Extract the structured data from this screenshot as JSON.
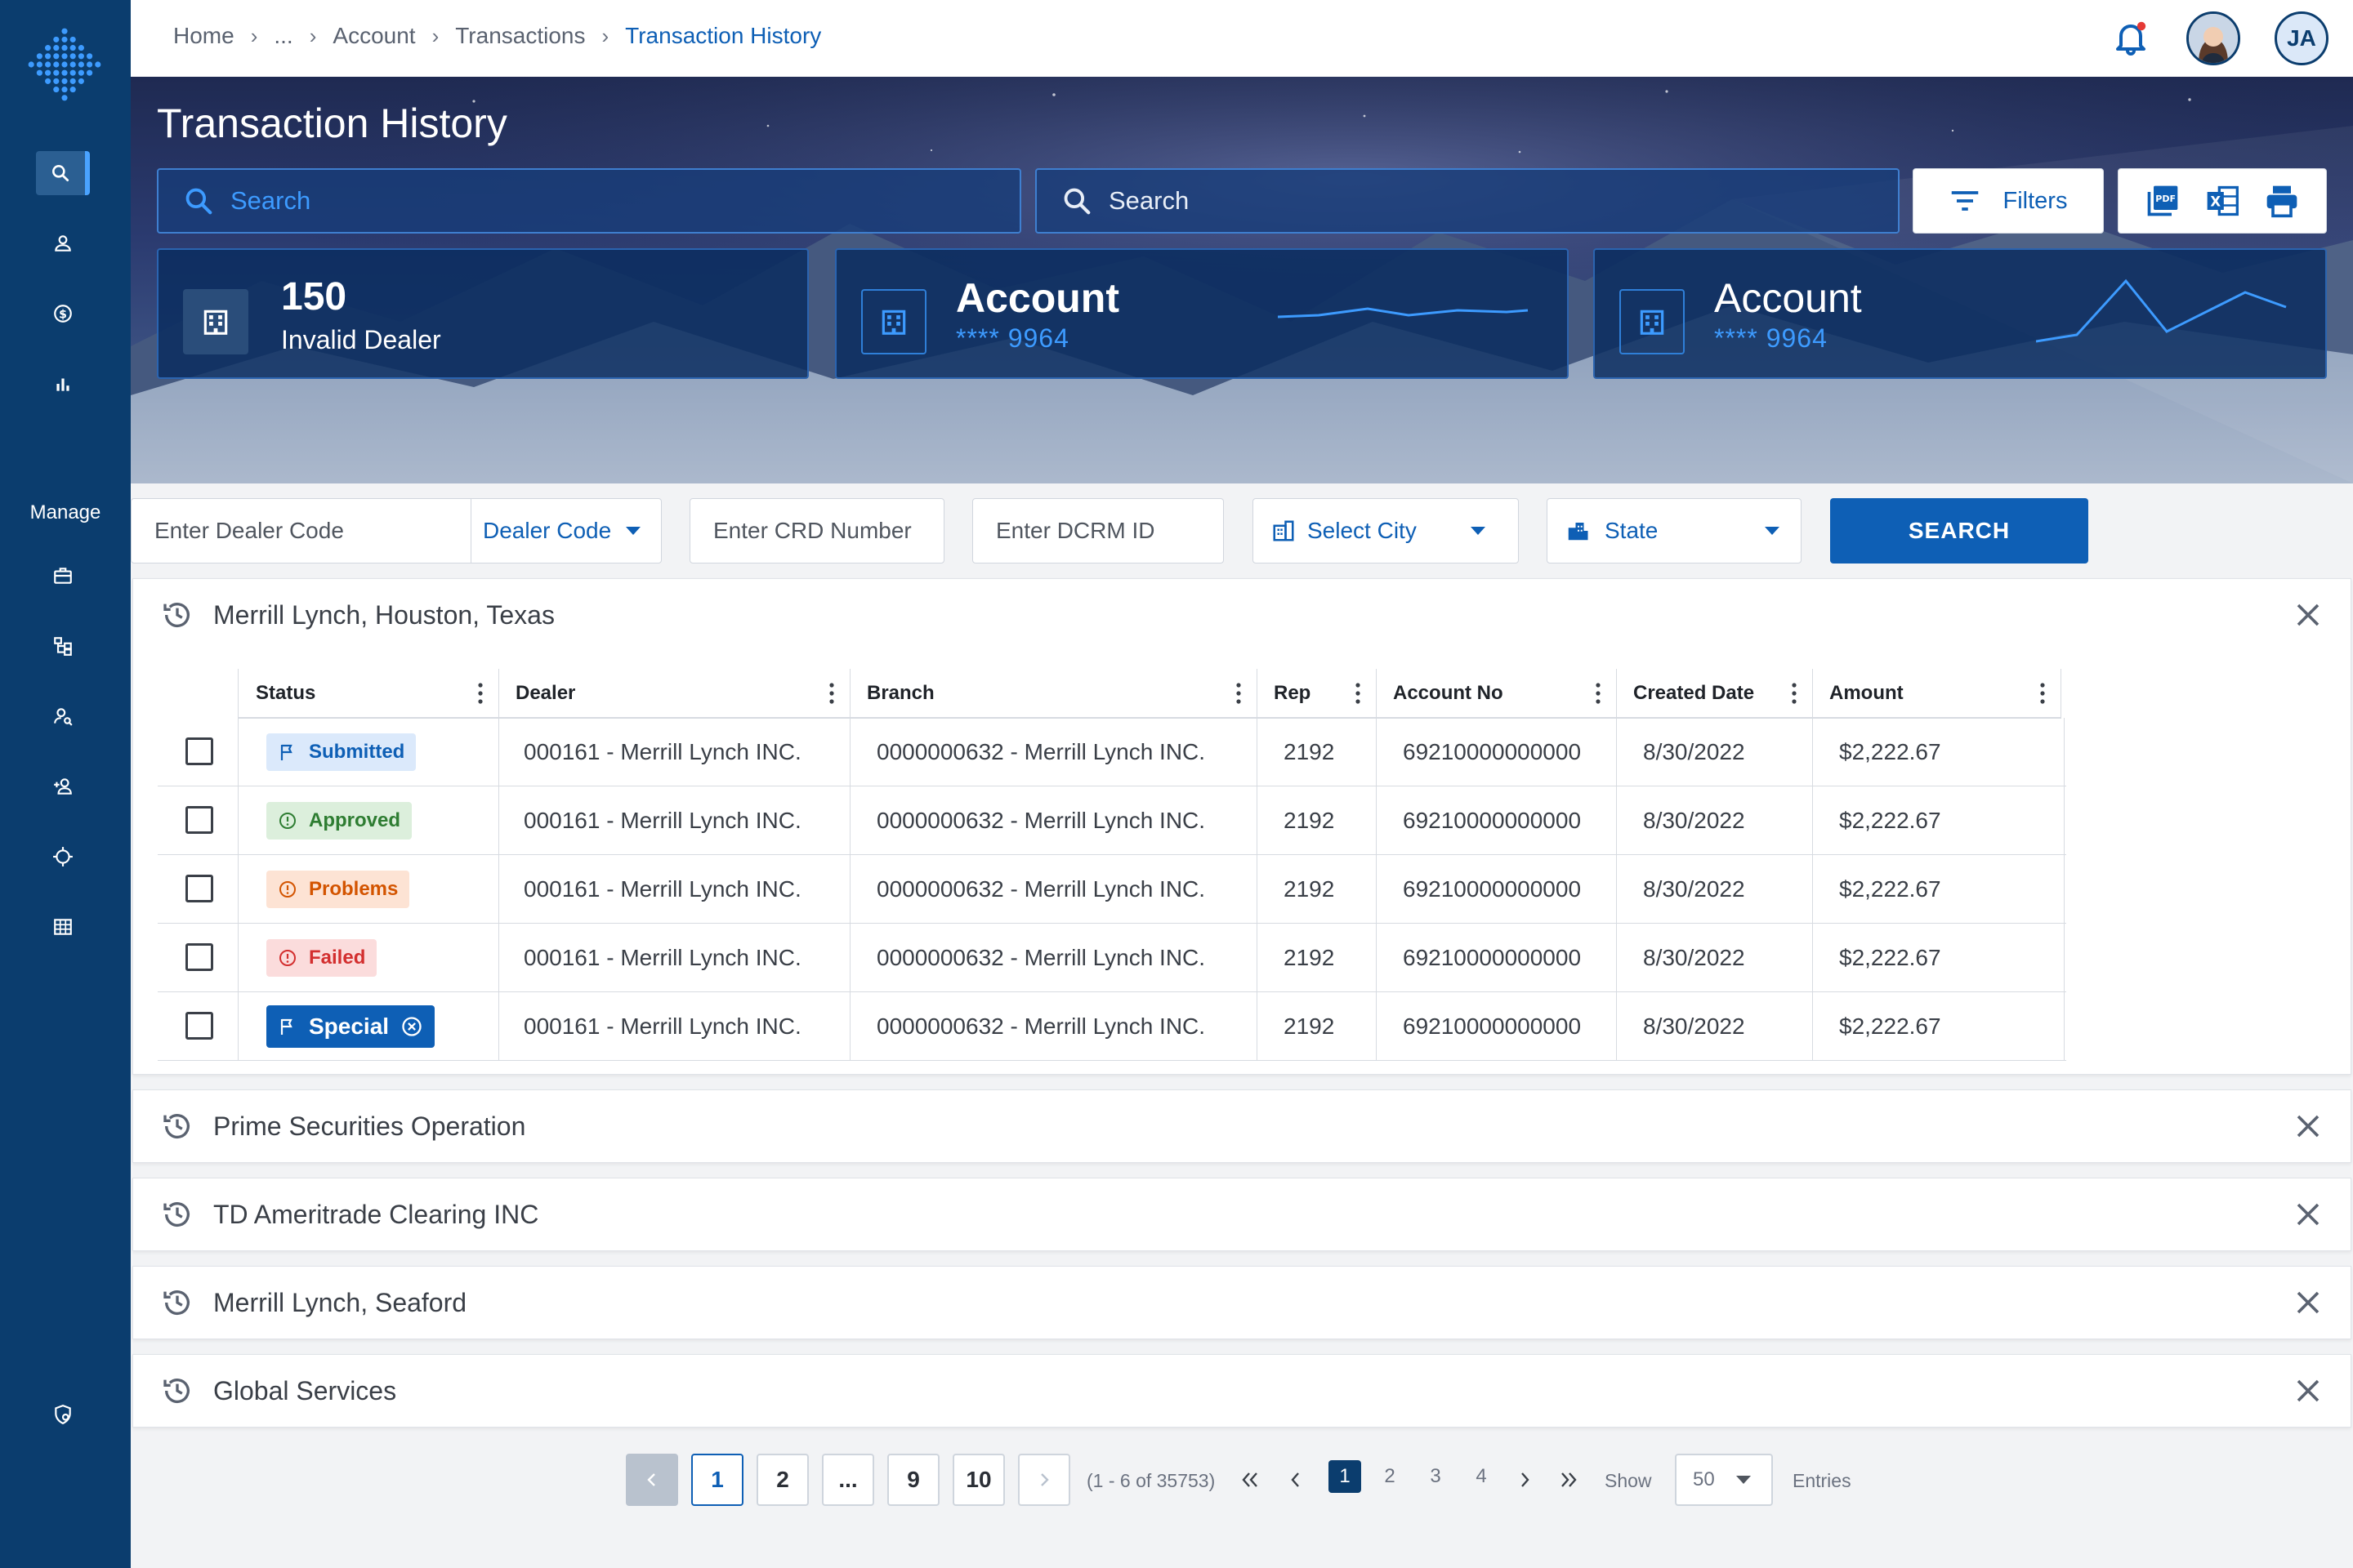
{
  "nav": {
    "manage_label": "Manage"
  },
  "breadcrumb": {
    "home": "Home",
    "ellipsis": "...",
    "account": "Account",
    "transactions": "Transactions",
    "current": "Transaction History"
  },
  "user": {
    "initials": "JA"
  },
  "hero": {
    "title": "Transaction History",
    "search1_placeholder": "Search",
    "search2_placeholder": "Search",
    "filters_label": "Filters"
  },
  "cards": [
    {
      "value": "150",
      "label": "Invalid Dealer"
    },
    {
      "title": "Account",
      "masked": "**** 9964"
    },
    {
      "title": "Account",
      "masked": "**** 9964"
    }
  ],
  "filters": {
    "dealer_code_placeholder": "Enter Dealer Code",
    "dealer_code_select": "Dealer Code",
    "crd_placeholder": "Enter CRD Number",
    "dcrm_placeholder": "Enter DCRM ID",
    "city_select": "Select City",
    "state_select": "State",
    "search_button": "SEARCH"
  },
  "table": {
    "columns": [
      "Status",
      "Dealer",
      "Branch",
      "Rep",
      "Account No",
      "Created Date",
      "Amount"
    ],
    "rows": [
      {
        "status": "Submitted",
        "dealer": "000161 - Merrill  Lynch INC.",
        "branch": "0000000632 - Merrill  Lynch INC.",
        "rep": "2192",
        "account": "69210000000000",
        "date": "8/30/2022",
        "amount": "$2,222.67"
      },
      {
        "status": "Approved",
        "dealer": "000161 - Merrill  Lynch INC.",
        "branch": "0000000632 - Merrill  Lynch INC.",
        "rep": "2192",
        "account": "69210000000000",
        "date": "8/30/2022",
        "amount": "$2,222.67"
      },
      {
        "status": "Problems",
        "dealer": "000161 - Merrill  Lynch INC.",
        "branch": "0000000632 - Merrill  Lynch INC.",
        "rep": "2192",
        "account": "69210000000000",
        "date": "8/30/2022",
        "amount": "$2,222.67"
      },
      {
        "status": "Failed",
        "dealer": "000161 - Merrill  Lynch INC.",
        "branch": "0000000632 - Merrill  Lynch INC.",
        "rep": "2192",
        "account": "69210000000000",
        "date": "8/30/2022",
        "amount": "$2,222.67"
      },
      {
        "status": "Special",
        "dealer": "000161 - Merrill  Lynch INC.",
        "branch": "0000000632 - Merrill  Lynch INC.",
        "rep": "2192",
        "account": "69210000000000",
        "date": "8/30/2022",
        "amount": "$2,222.67"
      }
    ]
  },
  "panels": [
    "Merrill  Lynch, Houston, Texas",
    "Prime Securities Operation",
    "TD Ameritrade Clearing INC",
    "Merrill  Lynch, Seaford",
    "Global Services"
  ],
  "pagination": {
    "pages": [
      "1",
      "2",
      "...",
      "9",
      "10"
    ],
    "range_text": "(1 - 6 of 35753)",
    "mini_pages": [
      "1",
      "2",
      "3",
      "4"
    ],
    "show_label": "Show",
    "entries_value": "50",
    "entries_label": "Entries"
  },
  "colors": {
    "sidebar": "#0b3d6e",
    "primary": "#0e5fb5",
    "accent_blue": "#3d9bff"
  }
}
